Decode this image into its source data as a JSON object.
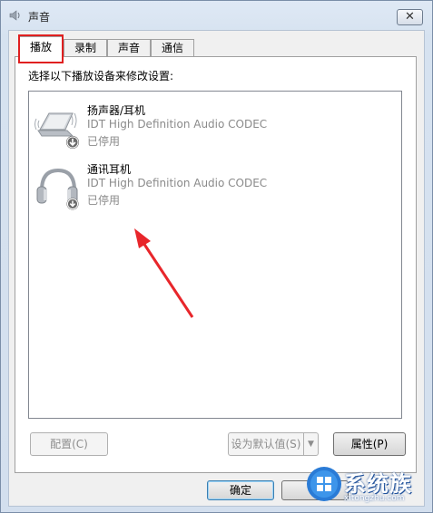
{
  "window": {
    "title": "声音",
    "close_symbol": "✕"
  },
  "tabs": [
    {
      "label": "播放",
      "active": true
    },
    {
      "label": "录制",
      "active": false
    },
    {
      "label": "声音",
      "active": false
    },
    {
      "label": "通信",
      "active": false
    }
  ],
  "panel": {
    "instruction": "选择以下播放设备来修改设置:"
  },
  "devices": [
    {
      "name": "扬声器/耳机",
      "driver": "IDT High Definition Audio CODEC",
      "status": "已停用",
      "icon": "speaker-laptop-icon"
    },
    {
      "name": "通讯耳机",
      "driver": "IDT High Definition Audio CODEC",
      "status": "已停用",
      "icon": "headphones-icon"
    }
  ],
  "buttons": {
    "configure": "配置(C)",
    "set_default": "设为默认值(S)",
    "properties": "属性(P)",
    "ok": "确定"
  },
  "watermark": {
    "text": "系统族",
    "url": "xitongzhu.com"
  },
  "colors": {
    "highlight_border": "#e02020",
    "annotation_arrow": "#e8262b"
  }
}
